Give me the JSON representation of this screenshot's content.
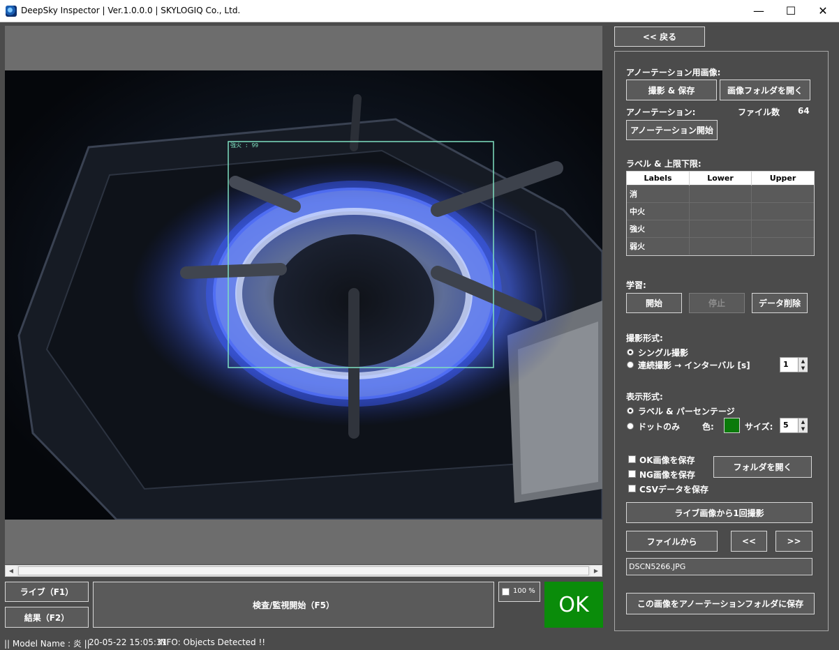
{
  "window": {
    "title": "DeepSky Inspector | Ver.1.0.0.0 | SKYLOGIQ Co., Ltd.",
    "controls": {
      "minimize": "—",
      "maximize": "☐",
      "close": "✕"
    }
  },
  "viewer": {
    "detection_label": "強火 : 99",
    "detection_color": "#7fe0c0"
  },
  "bottom": {
    "live_button": "ライブ（F1）",
    "results_button": "結果（F2）",
    "inspect_button": "検査/監視開始（F5）",
    "zoom_label": "100 %",
    "zoom_checked": false,
    "verdict": "OK",
    "verdict_color": "#0a8c0a"
  },
  "status": {
    "model": "|| Model Name : 炎 ||",
    "timestamp": "20-05-22 15:05:31",
    "info": "INFO:   Objects Detected !!"
  },
  "panel": {
    "back_button": "<< 戻る",
    "annotation_images_label": "アノーテーション用画像:",
    "capture_save_button": "撮影 & 保存",
    "open_image_folder_button": "画像フォルダを開く",
    "annotation_label": "アノーテーション:",
    "file_count_label": "ファイル数",
    "file_count_value": "64",
    "annotation_start_button": "アノーテーション開始",
    "labels_section_label": "ラベル & 上限下限:",
    "table": {
      "headers": [
        "Labels",
        "Lower",
        "Upper"
      ],
      "rows": [
        {
          "label": "消",
          "lower": "",
          "upper": ""
        },
        {
          "label": "中火",
          "lower": "",
          "upper": ""
        },
        {
          "label": "強火",
          "lower": "",
          "upper": ""
        },
        {
          "label": "弱火",
          "lower": "",
          "upper": ""
        }
      ]
    },
    "learning_label": "学習:",
    "learn_start_button": "開始",
    "learn_stop_button": "停止",
    "delete_data_button": "データ削除",
    "capture_mode_label": "撮影形式:",
    "single_capture_label": "シングル撮影",
    "continuous_capture_label": "連続撮影 → インターバル [s]",
    "capture_mode_selected": "single",
    "interval_value": "1",
    "display_mode_label": "表示形式:",
    "label_percent_label": "ラベル & パーセンテージ",
    "dots_only_label": "ドットのみ",
    "display_mode_selected": "label",
    "color_label": "色:",
    "dot_color": "#0a7a0a",
    "size_label": "サイズ:",
    "size_value": "5",
    "save_ok_label": "OK画像を保存",
    "save_ng_label": "NG画像を保存",
    "save_csv_label": "CSVデータを保存",
    "open_folder_button": "フォルダを開く",
    "capture_once_button": "ライブ画像から1回撮影",
    "from_file_button": "ファイルから",
    "prev_button": "<<",
    "next_button": ">>",
    "current_file": "DSCN5266.JPG",
    "save_to_annotation_button": "この画像をアノーテーションフォルダに保存"
  }
}
